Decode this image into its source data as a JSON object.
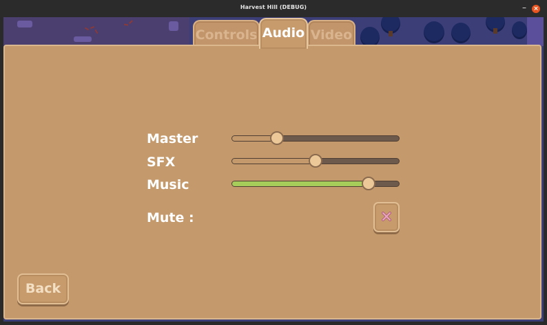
{
  "window": {
    "title": "Harvest Hill (DEBUG)",
    "minimize": "–",
    "close": "×"
  },
  "tabs": [
    {
      "label": "Controls",
      "active": false
    },
    {
      "label": "Audio",
      "active": true
    },
    {
      "label": "Video",
      "active": false
    }
  ],
  "audio": {
    "sliders": [
      {
        "label": "Master",
        "value": 0.27,
        "fill_color": "#c49a6c"
      },
      {
        "label": "SFX",
        "value": 0.5,
        "fill_color": "#c49a6c"
      },
      {
        "label": "Music",
        "value": 0.82,
        "fill_color": "#a6cc5a"
      }
    ],
    "mute": {
      "label": "Mute :",
      "icon": "x-icon",
      "checked": false
    }
  },
  "back_button": {
    "label": "Back"
  },
  "colors": {
    "panel": "#c49a6c",
    "knob": "#ecc898",
    "music_fill": "#a6cc5a",
    "close_button": "#e95420"
  }
}
